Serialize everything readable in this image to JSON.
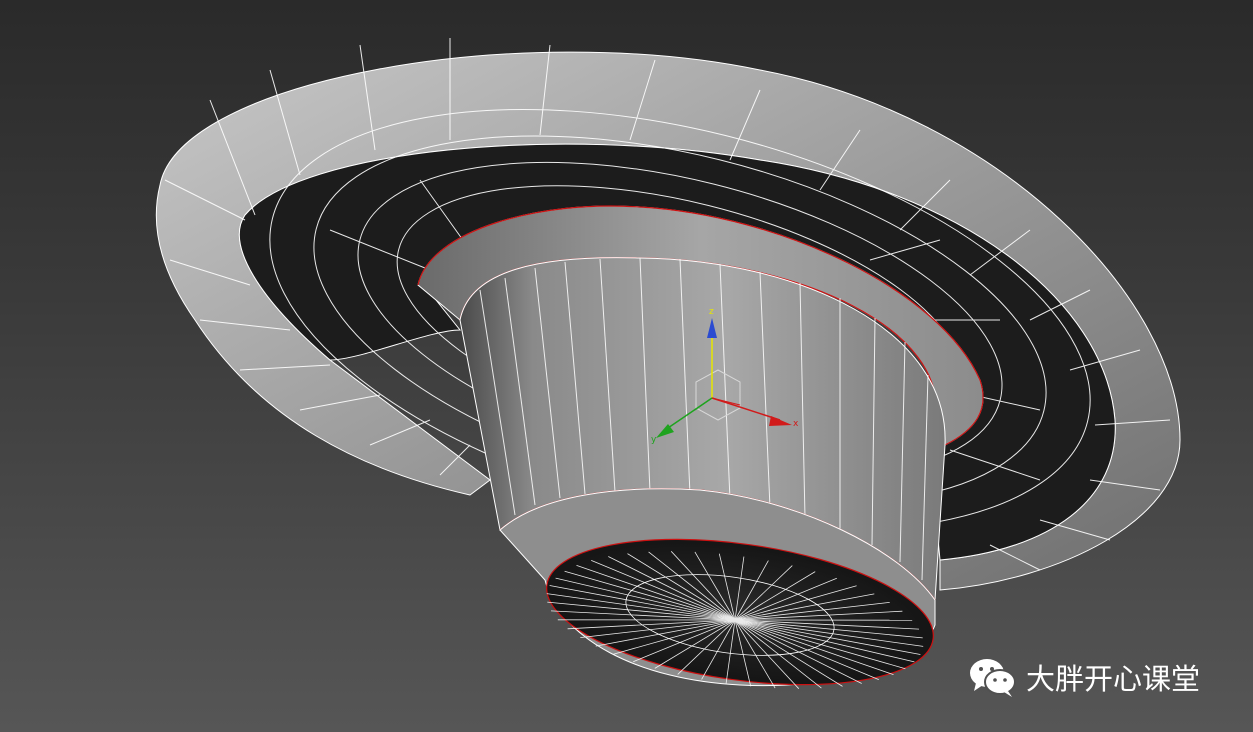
{
  "viewport": {
    "background_top": "#2a2a2a",
    "background_bottom": "#565656",
    "mesh_wire_color": "#ffffff",
    "selection_edge_color": "#cc1111"
  },
  "gizmo": {
    "x_label": "x",
    "y_label": "y",
    "z_label": "z",
    "x_color": "#d11a1a",
    "y_color": "#1fa31f",
    "z_color": "#2a4bd1"
  },
  "watermark": {
    "icon": "wechat-icon",
    "text": "大胖开心课堂"
  }
}
